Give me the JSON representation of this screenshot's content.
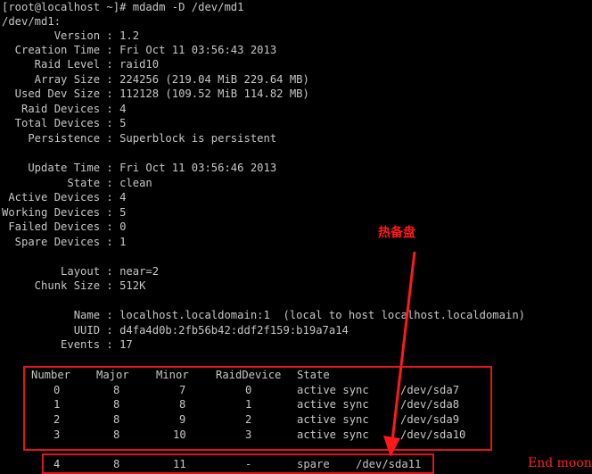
{
  "terminal": {
    "prompt": "[root@localhost ~]# mdadm -D /dev/md1",
    "device": "/dev/md1:",
    "details": [
      "        Version : 1.2",
      "  Creation Time : Fri Oct 11 03:56:43 2013",
      "     Raid Level : raid10",
      "     Array Size : 224256 (219.04 MiB 229.64 MB)",
      "  Used Dev Size : 112128 (109.52 MiB 114.82 MB)",
      "   Raid Devices : 4",
      "  Total Devices : 5",
      "    Persistence : Superblock is persistent",
      "",
      "    Update Time : Fri Oct 11 03:56:46 2013",
      "          State : clean",
      " Active Devices : 4",
      "Working Devices : 5",
      " Failed Devices : 0",
      "  Spare Devices : 1",
      "",
      "         Layout : near=2",
      "     Chunk Size : 512K",
      "",
      "           Name : localhost.localdomain:1  (local to host localhost.localdomain)",
      "           UUID : d4fa4d0b:2fb56b42:ddf2f159:b19a7a14",
      "         Events : 17"
    ],
    "table_headers": [
      "Number",
      "Major",
      "Minor",
      "RaidDevice",
      "State"
    ],
    "table_rows": [
      [
        "0",
        "8",
        "7",
        "0",
        "active sync",
        "/dev/sda7"
      ],
      [
        "1",
        "8",
        "8",
        "1",
        "active sync",
        "/dev/sda8"
      ],
      [
        "2",
        "8",
        "9",
        "2",
        "active sync",
        "/dev/sda9"
      ],
      [
        "3",
        "8",
        "10",
        "3",
        "active sync",
        "/dev/sda10"
      ]
    ],
    "spare_row": [
      "4",
      "8",
      "11",
      "-",
      "spare",
      "/dev/sda11"
    ]
  },
  "annotation": {
    "label": "热备盘",
    "color": "#ff1a1a"
  },
  "watermark": "End moon",
  "colors": {
    "background": "#000000",
    "text": "#c6c6c6",
    "highlight": "#e0141e"
  }
}
